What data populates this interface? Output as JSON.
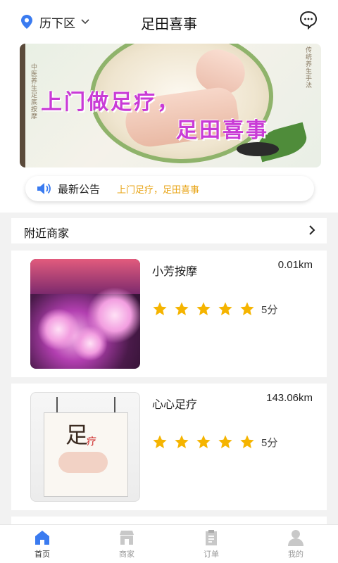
{
  "header": {
    "location": "历下区",
    "title": "足田喜事"
  },
  "banner": {
    "slogan_line1": "上门做足疗，",
    "slogan_line2": "足田喜事",
    "side_text_left": "中医养生足底按摩",
    "side_text_right": "传统养生手法"
  },
  "notice": {
    "label": "最新公告",
    "text": "上门足疗，足田喜事"
  },
  "nearby": {
    "title": "附近商家"
  },
  "shops": [
    {
      "name": "小芳按摩",
      "distance": "0.01km",
      "rating": 5,
      "rating_text": "5分"
    },
    {
      "name": "心心足疗",
      "distance": "143.06km",
      "rating": 5,
      "rating_text": "5分"
    }
  ],
  "poster": {
    "big_char": "足",
    "small_text": "疗"
  },
  "tabbar": {
    "items": [
      {
        "label": "首页",
        "icon": "home-icon",
        "active": true
      },
      {
        "label": "商家",
        "icon": "store-icon",
        "active": false
      },
      {
        "label": "订单",
        "icon": "clipboard-icon",
        "active": false
      },
      {
        "label": "我的",
        "icon": "person-icon",
        "active": false
      }
    ]
  },
  "colors": {
    "accent": "#3a7bf0",
    "star": "#f5b400",
    "notice_text": "#e8a416",
    "slogan": "#c93bd6"
  }
}
